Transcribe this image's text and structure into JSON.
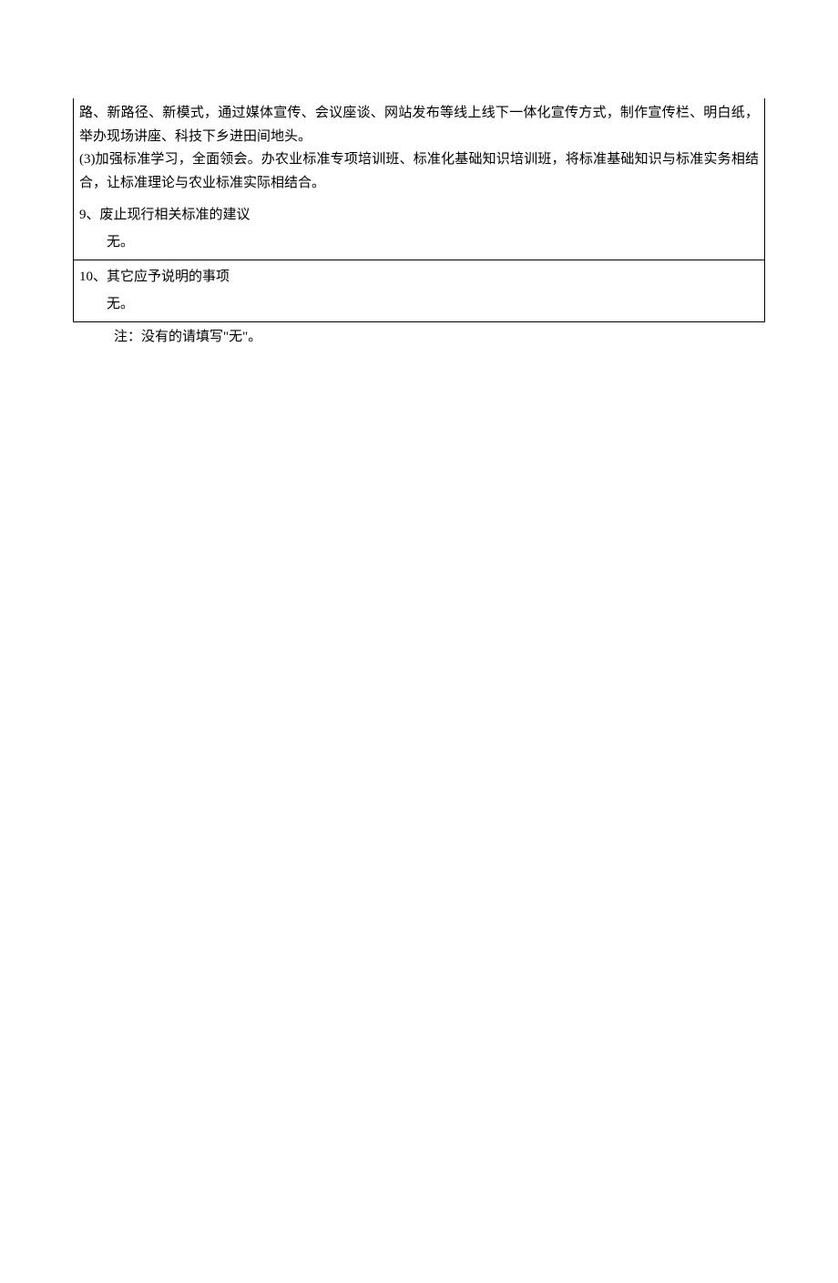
{
  "section_top": {
    "paragraph1": "路、新路径、新模式，通过媒体宣传、会议座谈、网站发布等线上线下一体化宣传方式，制作宣传栏、明白纸，举办现场讲座、科技下乡进田间地头。",
    "paragraph2": "(3)加强标准学习，全面领会。办农业标准专项培训班、标准化基础知识培训班，将标准基础知识与标准实务相结合，让标准理论与农业标准实际相结合。"
  },
  "section9": {
    "heading": "9、废止现行相关标准的建议",
    "answer": "无。"
  },
  "section10": {
    "heading": "10、其它应予说明的事项",
    "answer": "无。"
  },
  "note": "注：没有的请填写\"无\"。"
}
